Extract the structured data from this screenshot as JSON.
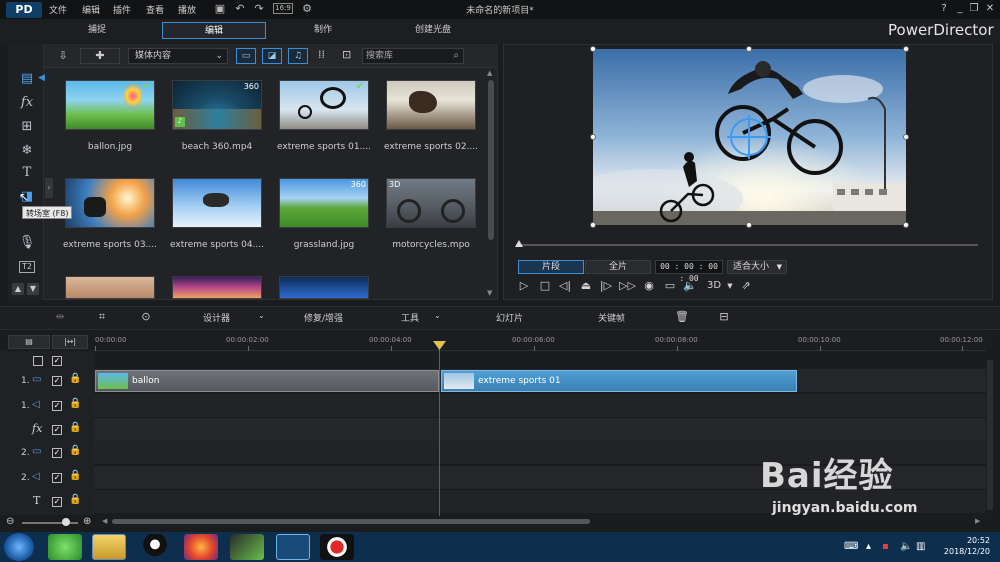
{
  "menu": [
    "文件",
    "编辑",
    "插件",
    "查看",
    "播放"
  ],
  "window_title": "未命名的新项目*",
  "window_buttons": [
    "?",
    "_",
    "❐",
    "✕"
  ],
  "modes": [
    {
      "label": "捕捉",
      "active": false
    },
    {
      "label": "编辑",
      "active": true
    },
    {
      "label": "制作",
      "active": false
    },
    {
      "label": "创建光盘",
      "active": false
    }
  ],
  "brand": "PowerDirector",
  "library": {
    "filter_select": "媒体内容",
    "search_placeholder": "搜索库",
    "items": [
      {
        "name": "ballon.jpg",
        "badge": "",
        "checked": true
      },
      {
        "name": "beach 360.mp4",
        "badge": "360",
        "checked": false
      },
      {
        "name": "extreme sports 01....",
        "badge": "",
        "checked": true
      },
      {
        "name": "extreme sports 02....",
        "badge": "",
        "checked": false
      },
      {
        "name": "extreme sports 03....",
        "badge": "",
        "checked": false
      },
      {
        "name": "extreme sports 04....",
        "badge": "",
        "checked": false
      },
      {
        "name": "grassland.jpg",
        "badge": "360",
        "checked": false
      },
      {
        "name": "motorcycles.mpo",
        "badge": "3D",
        "checked": false
      }
    ]
  },
  "tooltip": "转场室 (F8)",
  "preview": {
    "clip_tab": "片段",
    "full_tab": "全片",
    "timecode": "00 : 00 : 00 : 00",
    "fit": "适合大小",
    "mode_3d": "3D"
  },
  "edit_toolbar": {
    "designer": "设计器",
    "fix": "修复/增强",
    "tools": "工具",
    "slideshow": "幻灯片",
    "keyframe": "关键帧"
  },
  "ruler": [
    "00:00:00",
    "00:00:02:00",
    "00:00:04:00",
    "00:00:06:00",
    "00:00:08:00",
    "00:00:10:00",
    "00:00:12:00"
  ],
  "tracks": [
    "1.",
    "1.",
    "",
    "2.",
    "2.",
    ""
  ],
  "clips": [
    {
      "label": "ballon"
    },
    {
      "label": "extreme sports 01"
    }
  ],
  "clock": {
    "time": "20:52",
    "date": "2018/12/20"
  },
  "watermark": {
    "main": "Bai经验",
    "sub": "jingyan.baidu.com"
  }
}
